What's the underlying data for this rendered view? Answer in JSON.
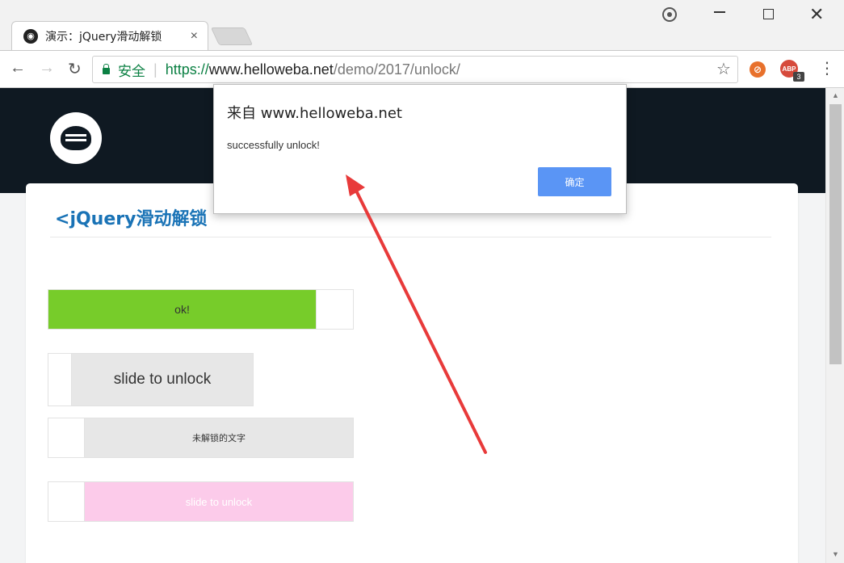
{
  "browser": {
    "tab_title": "演示：jQuery滑动解锁",
    "tab_close": "×",
    "secure_label": "安全",
    "url_scheme": "https://",
    "url_host": "www.helloweba.net",
    "url_path": "/demo/2017/unlock/",
    "extension_badge": "3"
  },
  "page": {
    "title": "jQuery滑动解锁",
    "sliders": [
      {
        "label": "ok!",
        "progress": 0.87
      },
      {
        "label": "slide to unlock"
      },
      {
        "label": "未解锁的文字"
      },
      {
        "label": "slide to unlock"
      }
    ]
  },
  "dialog": {
    "title": "来自 www.helloweba.net",
    "message": "successfully unlock!",
    "ok_label": "确定"
  },
  "colors": {
    "header_bg": "#0f1922",
    "success_green": "#77cc2a",
    "link_blue": "#1a73b6",
    "pink": "#fccbea",
    "dialog_button": "#5a95f5",
    "annotation_red": "#e83a3a"
  }
}
